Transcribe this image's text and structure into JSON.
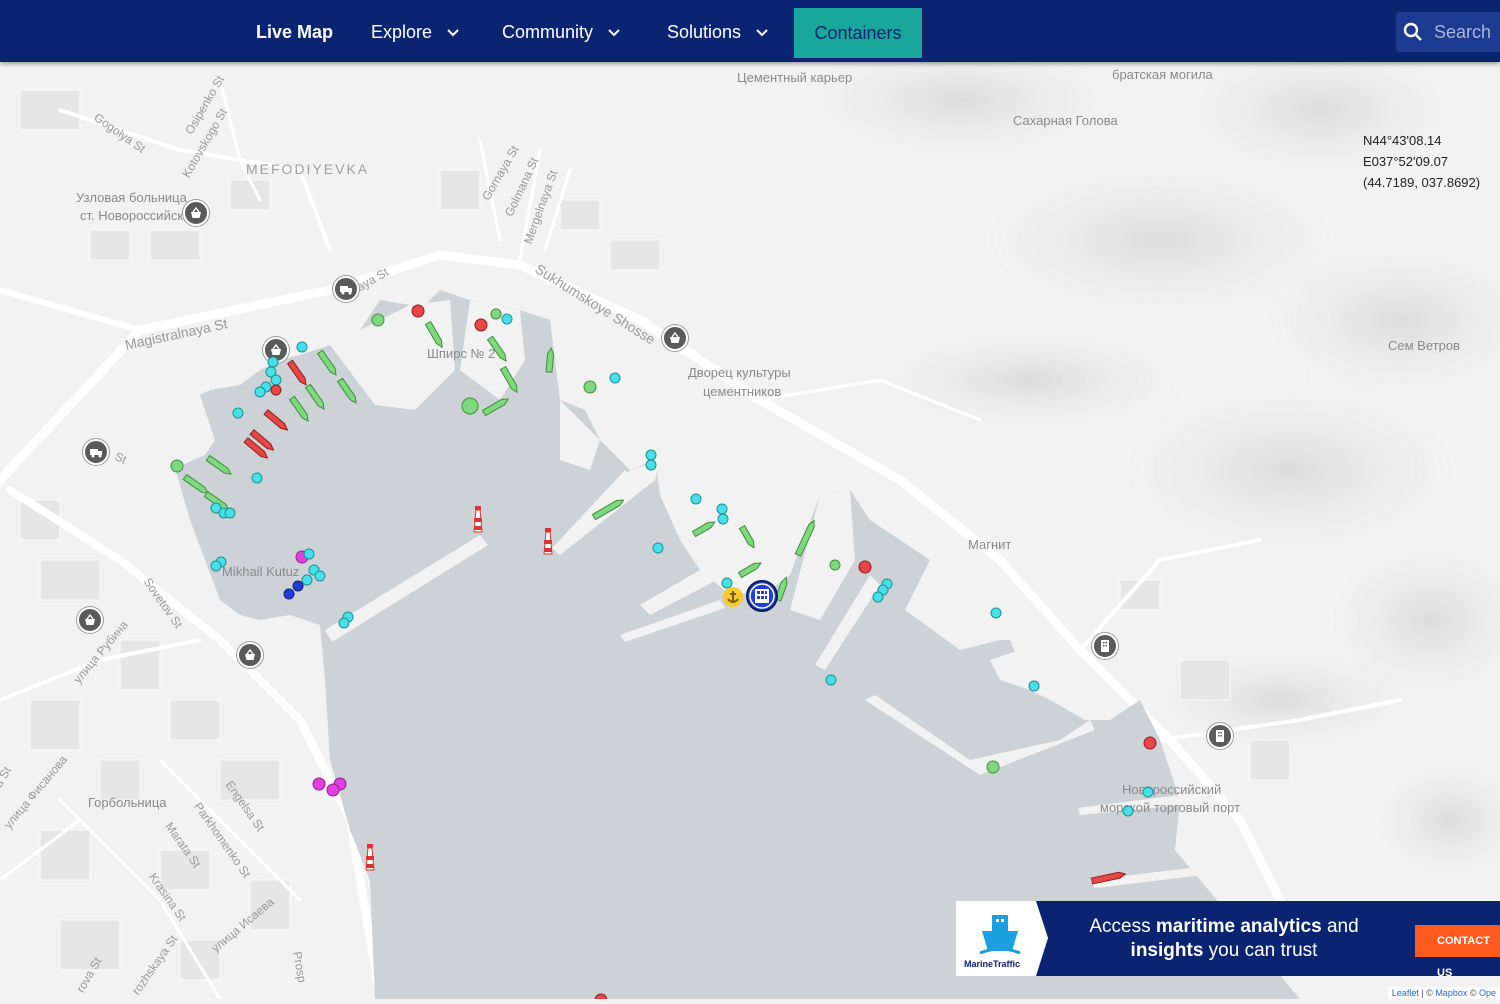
{
  "nav": {
    "live_map": "Live Map",
    "explore": "Explore",
    "community": "Community",
    "solutions": "Solutions",
    "containers": "Containers",
    "search_placeholder": "Search",
    "search_icon": "search-icon",
    "dropdown_icon": "chevron-down-icon"
  },
  "colors": {
    "nav_bg": "#0b2472",
    "containers_bg": "#19a79b",
    "water": "#cdd2d6",
    "land": "#f2f2f2",
    "cargo_vessel": "#7ed87e",
    "tanker_vessel": "#e84545",
    "passenger_vessel": "#48e0e8",
    "tug_vessel": "#e040e0",
    "other_vessel": "#1f3fd8",
    "ad_cta": "#ff5a1f"
  },
  "coordinates": {
    "lat": "N44°43'08.14",
    "lon": "E037°52'09.07",
    "decimal": "(44.7189, 037.8692)"
  },
  "labels": {
    "cement_quarry": "Цементный карьер",
    "mass_grave": "братская могила",
    "sugarloaf": "Сахарная Голова",
    "sem_vetrov": "Сем Ветров",
    "mefodiyevka": "MEFODIYEVKA",
    "hospital_1": "Узловая больница",
    "hospital_2": "ст. Новороссийск",
    "pier": "Шпирс № 2",
    "palace_1": "Дворец культуры",
    "palace_2": "цементников",
    "magnit": "Магнит",
    "port_1": "Новороссийский",
    "port_2": "морской торговый порт",
    "gorbolnitsa": "Горбольница",
    "kutuz": "Mikhail Kutuz",
    "isaeva": "улица Исаева",
    "rubina": "улица Рубина",
    "fisanova": "улица Фисанова"
  },
  "streets": {
    "gogolya": "Gogolya St",
    "osipenko": "Osipenko St",
    "kotovskogo": "Kotovskogo St",
    "gornaya": "Gornaya St",
    "golmana": "Golmana St",
    "mergelnaya": "Mergelnaya St",
    "sukhumskoye": "Sukhumskoye Shosse",
    "magistralnaya": "Magistralnaya St",
    "vaya": "vaya St",
    "st": "St",
    "sovetov": "Sovetov St",
    "engelsa": "Engelsa St",
    "parkhomenko": "Parkhomenko St",
    "marata": "Marata St",
    "krasina": "Krasina St",
    "rozhskaya": "rozhskaya St",
    "rova": "rova St",
    "prosp": "Prosp",
    "a_st": "a St"
  },
  "ad": {
    "brand": "MarineTraffic",
    "line1_pre": "Access ",
    "line1_bold": "maritime analytics",
    "line1_post": " and",
    "line2_bold": "insights",
    "line2_post": " you can trust",
    "cta": "CONTACT US"
  },
  "attribution": {
    "leaflet": "Leaflet",
    "sep": " | © ",
    "mapbox": "Mapbox",
    "sep2": " © ",
    "osm": "Ope"
  }
}
